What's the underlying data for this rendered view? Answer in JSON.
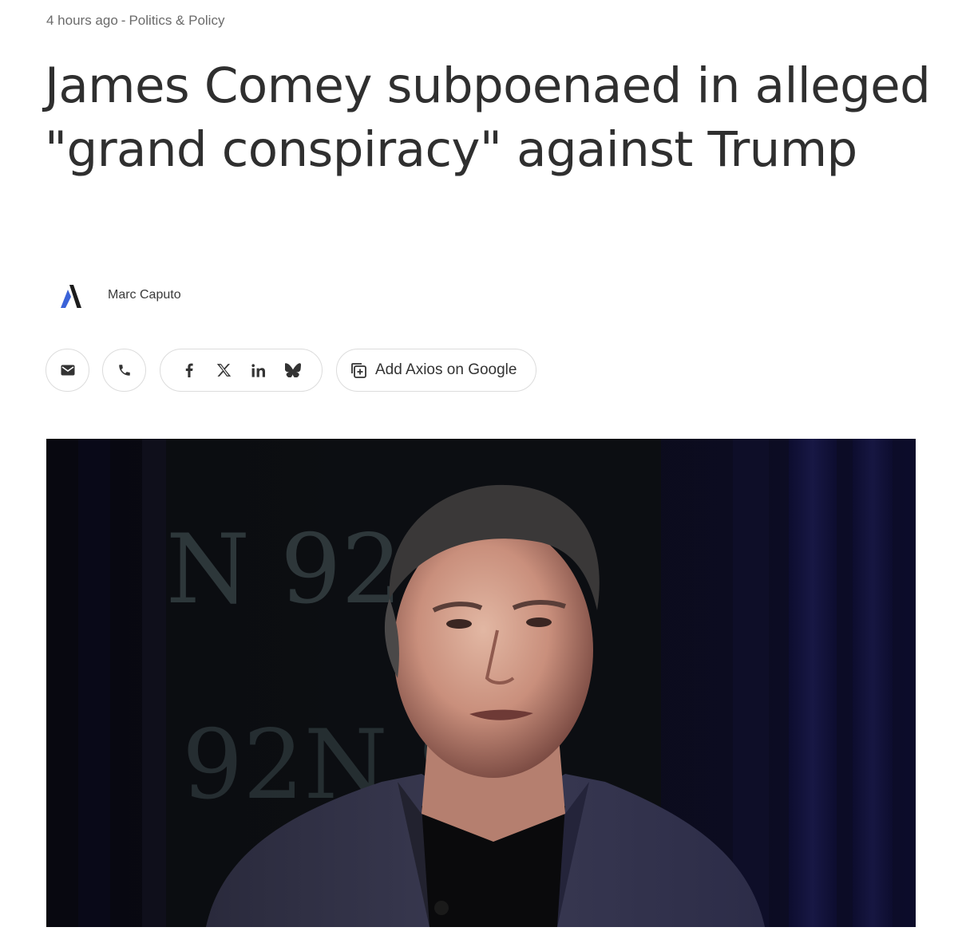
{
  "meta": {
    "time_ago": "4 hours ago",
    "separator": "-",
    "category": "Politics & Policy"
  },
  "article": {
    "headline": "James Comey subpoenaed in alleged \"grand conspiracy\" against Trump",
    "author": "Marc Caputo"
  },
  "share": {
    "email_icon": "email-icon",
    "phone_icon": "phone-icon",
    "facebook_icon": "facebook-icon",
    "x_icon": "x-icon",
    "linkedin_icon": "linkedin-icon",
    "bluesky_icon": "bluesky-icon",
    "google_label": "Add Axios on Google",
    "google_icon": "add-to-google-icon"
  },
  "photo": {
    "backdrop_text_top": "N 92N",
    "backdrop_text_bottom": "92N 9"
  },
  "colors": {
    "logo_dark": "#1c1c1c",
    "logo_blue": "#3b63d8",
    "text": "#333333",
    "meta": "#6b6b6b",
    "border": "#dcdcdc"
  }
}
